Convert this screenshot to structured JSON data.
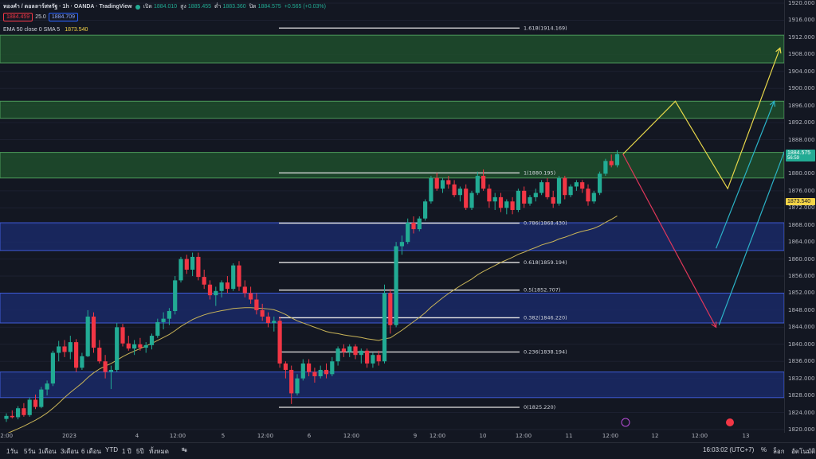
{
  "header": {
    "title": "ทองคำ / ดอลลาร์สหรัฐ · 1h · OANDA · TradingView",
    "ohlc": [
      {
        "label": "เปิด",
        "value": "1884.010"
      },
      {
        "label": "สูง",
        "value": "1885.455"
      },
      {
        "label": "ต่ำ",
        "value": "1883.360"
      },
      {
        "label": "ปิด",
        "value": "1884.575"
      }
    ],
    "change": "+0.565 (+0.03%)",
    "bid": "1884.459",
    "spread": "25.0",
    "ask": "1884.709",
    "indicator": "EMA 50 close 0 SMA 5",
    "indicator_value": "1873.540"
  },
  "price_tags": {
    "current": "1884.575",
    "countdown": "56:59",
    "ema": "1873.540"
  },
  "colors": {
    "background": "#131722",
    "up": "#22ab94",
    "down": "#f23645",
    "green_zone": "#1e4d2b",
    "blue_zone": "#1a2a6c",
    "ema": "#c9b458",
    "arrow_yellow": "#e8d84a",
    "arrow_cyan": "#2bb3c7",
    "arrow_red": "#e0375a"
  },
  "chart_data": {
    "type": "candlestick",
    "title": "ทองคำ / ดอลลาร์สหรัฐ · 1h · OANDA",
    "ylim": [
      1820,
      1920
    ],
    "y_ticks": [
      "1920.000",
      "1916.000",
      "1912.000",
      "1908.000",
      "1904.000",
      "1900.000",
      "1896.000",
      "1892.000",
      "1888.000",
      "1884.000",
      "1880.000",
      "1876.000",
      "1872.000",
      "1868.000",
      "1864.000",
      "1860.000",
      "1856.000",
      "1852.000",
      "1848.000",
      "1844.000",
      "1840.000",
      "1836.000",
      "1832.000",
      "1828.000",
      "1824.000",
      "1820.000"
    ],
    "x_ticks": [
      "12:00",
      "2023",
      "4",
      "12:00",
      "5",
      "12:00",
      "6",
      "12:00",
      "9",
      "12:00",
      "10",
      "12:00",
      "11",
      "12:00",
      "12",
      "12:00",
      "13"
    ],
    "fib_levels": [
      {
        "label": "1.618(1914.169)",
        "price": 1914.169
      },
      {
        "label": "1(1880.195)",
        "price": 1880.195
      },
      {
        "label": "0.786(1868.430)",
        "price": 1868.43
      },
      {
        "label": "0.618(1859.194)",
        "price": 1859.194
      },
      {
        "label": "0.5(1852.707)",
        "price": 1852.707
      },
      {
        "label": "0.382(1846.220)",
        "price": 1846.22
      },
      {
        "label": "0.236(1838.194)",
        "price": 1838.194
      },
      {
        "label": "0(1825.220)",
        "price": 1825.22
      }
    ],
    "zones": [
      {
        "kind": "supply",
        "top": 1912.5,
        "bottom": 1906.0
      },
      {
        "kind": "supply",
        "top": 1897.0,
        "bottom": 1893.0
      },
      {
        "kind": "supply",
        "top": 1885.0,
        "bottom": 1879.0
      },
      {
        "kind": "demand",
        "top": 1868.5,
        "bottom": 1862.0
      },
      {
        "kind": "demand",
        "top": 1852.0,
        "bottom": 1845.0
      },
      {
        "kind": "demand",
        "top": 1833.5,
        "bottom": 1827.5
      }
    ],
    "candles": [
      [
        1822.5,
        1823.8,
        1821.8,
        1823.2
      ],
      [
        1823.2,
        1824.5,
        1822.6,
        1822.9
      ],
      [
        1822.9,
        1825.5,
        1822.4,
        1825.0
      ],
      [
        1825.0,
        1826.2,
        1823.0,
        1823.4
      ],
      [
        1823.4,
        1827.5,
        1823.0,
        1827.0
      ],
      [
        1827.0,
        1828.2,
        1824.8,
        1825.3
      ],
      [
        1825.3,
        1830.0,
        1825.0,
        1829.4
      ],
      [
        1829.4,
        1831.5,
        1828.0,
        1830.8
      ],
      [
        1830.8,
        1838.5,
        1830.2,
        1838.0
      ],
      [
        1838.0,
        1840.8,
        1836.0,
        1839.5
      ],
      [
        1839.5,
        1841.0,
        1837.0,
        1838.2
      ],
      [
        1838.2,
        1842.0,
        1836.5,
        1840.5
      ],
      [
        1840.5,
        1841.2,
        1833.5,
        1834.5
      ],
      [
        1834.5,
        1838.0,
        1834.0,
        1837.2
      ],
      [
        1837.2,
        1848.0,
        1837.0,
        1846.5
      ],
      [
        1846.5,
        1847.5,
        1838.0,
        1839.2
      ],
      [
        1839.2,
        1841.0,
        1835.5,
        1836.0
      ],
      [
        1836.0,
        1837.5,
        1832.0,
        1833.5
      ],
      [
        1833.5,
        1835.0,
        1829.5,
        1834.0
      ],
      [
        1834.0,
        1845.0,
        1833.5,
        1844.0
      ],
      [
        1844.0,
        1844.8,
        1839.5,
        1840.2
      ],
      [
        1840.2,
        1842.0,
        1838.5,
        1839.0
      ],
      [
        1839.0,
        1841.0,
        1837.5,
        1840.0
      ],
      [
        1840.0,
        1841.5,
        1838.5,
        1839.2
      ],
      [
        1839.2,
        1840.5,
        1838.0,
        1839.8
      ],
      [
        1839.8,
        1842.5,
        1838.8,
        1842.0
      ],
      [
        1842.0,
        1846.0,
        1841.5,
        1845.2
      ],
      [
        1845.2,
        1847.5,
        1843.5,
        1846.0
      ],
      [
        1846.0,
        1848.5,
        1844.5,
        1847.8
      ],
      [
        1847.8,
        1856.0,
        1847.0,
        1855.0
      ],
      [
        1855.0,
        1860.5,
        1854.5,
        1860.0
      ],
      [
        1860.0,
        1861.0,
        1856.5,
        1857.5
      ],
      [
        1857.5,
        1861.5,
        1856.0,
        1860.5
      ],
      [
        1860.5,
        1861.5,
        1855.0,
        1855.8
      ],
      [
        1855.8,
        1857.5,
        1853.0,
        1854.0
      ],
      [
        1854.0,
        1855.0,
        1850.5,
        1851.5
      ],
      [
        1851.5,
        1853.5,
        1849.0,
        1852.5
      ],
      [
        1852.5,
        1855.0,
        1851.0,
        1854.5
      ],
      [
        1854.5,
        1856.0,
        1852.0,
        1853.0
      ],
      [
        1853.0,
        1859.0,
        1852.5,
        1858.5
      ],
      [
        1858.5,
        1859.5,
        1852.5,
        1853.5
      ],
      [
        1853.5,
        1855.0,
        1851.0,
        1852.0
      ],
      [
        1852.0,
        1853.5,
        1849.5,
        1850.5
      ],
      [
        1850.5,
        1852.0,
        1847.0,
        1848.0
      ],
      [
        1848.0,
        1849.5,
        1845.5,
        1846.5
      ],
      [
        1846.5,
        1847.5,
        1844.0,
        1845.0
      ],
      [
        1845.0,
        1846.5,
        1843.0,
        1845.5
      ],
      [
        1845.5,
        1846.5,
        1834.5,
        1835.5
      ],
      [
        1835.5,
        1836.0,
        1832.0,
        1834.0
      ],
      [
        1834.0,
        1835.0,
        1826.0,
        1828.5
      ],
      [
        1828.5,
        1833.0,
        1828.0,
        1832.0
      ],
      [
        1832.0,
        1836.5,
        1831.5,
        1835.5
      ],
      [
        1835.5,
        1836.5,
        1832.5,
        1833.5
      ],
      [
        1833.5,
        1834.5,
        1831.0,
        1832.5
      ],
      [
        1832.5,
        1835.0,
        1832.0,
        1834.0
      ],
      [
        1834.0,
        1835.5,
        1832.0,
        1833.0
      ],
      [
        1833.0,
        1837.0,
        1832.5,
        1836.0
      ],
      [
        1836.0,
        1839.5,
        1835.0,
        1839.0
      ],
      [
        1839.0,
        1840.0,
        1837.0,
        1838.2
      ],
      [
        1838.2,
        1840.0,
        1837.0,
        1839.5
      ],
      [
        1839.5,
        1840.0,
        1836.5,
        1837.5
      ],
      [
        1837.5,
        1839.0,
        1835.5,
        1838.5
      ],
      [
        1838.5,
        1839.0,
        1834.5,
        1835.5
      ],
      [
        1835.5,
        1838.0,
        1834.5,
        1837.5
      ],
      [
        1837.5,
        1838.5,
        1835.0,
        1836.0
      ],
      [
        1836.0,
        1854.0,
        1835.5,
        1852.0
      ],
      [
        1852.0,
        1853.0,
        1842.5,
        1844.5
      ],
      [
        1844.5,
        1864.0,
        1844.0,
        1863.0
      ],
      [
        1863.0,
        1865.5,
        1861.0,
        1864.0
      ],
      [
        1864.0,
        1869.5,
        1863.5,
        1868.5
      ],
      [
        1868.5,
        1870.0,
        1866.0,
        1867.0
      ],
      [
        1867.0,
        1870.0,
        1866.5,
        1869.5
      ],
      [
        1869.5,
        1874.0,
        1869.0,
        1873.5
      ],
      [
        1873.5,
        1879.5,
        1873.0,
        1879.0
      ],
      [
        1879.0,
        1880.2,
        1876.0,
        1876.5
      ],
      [
        1876.5,
        1879.0,
        1875.5,
        1878.5
      ],
      [
        1878.5,
        1879.5,
        1876.5,
        1877.5
      ],
      [
        1877.5,
        1878.5,
        1874.5,
        1875.0
      ],
      [
        1875.0,
        1877.0,
        1873.5,
        1876.5
      ],
      [
        1876.5,
        1877.5,
        1871.5,
        1872.0
      ],
      [
        1872.0,
        1876.0,
        1871.5,
        1875.5
      ],
      [
        1875.5,
        1880.5,
        1875.0,
        1879.5
      ],
      [
        1879.5,
        1881.0,
        1876.0,
        1876.5
      ],
      [
        1876.5,
        1877.5,
        1872.0,
        1873.5
      ],
      [
        1873.5,
        1875.5,
        1871.5,
        1874.5
      ],
      [
        1874.5,
        1875.5,
        1871.0,
        1872.0
      ],
      [
        1872.0,
        1874.0,
        1870.5,
        1873.5
      ],
      [
        1873.5,
        1874.5,
        1870.5,
        1871.5
      ],
      [
        1871.5,
        1876.5,
        1871.0,
        1876.0
      ],
      [
        1876.0,
        1877.0,
        1872.0,
        1873.0
      ],
      [
        1873.0,
        1875.0,
        1872.5,
        1874.5
      ],
      [
        1874.5,
        1876.5,
        1873.5,
        1875.5
      ],
      [
        1875.5,
        1878.5,
        1875.0,
        1878.0
      ],
      [
        1878.0,
        1879.0,
        1874.0,
        1874.5
      ],
      [
        1874.5,
        1876.0,
        1872.0,
        1873.0
      ],
      [
        1873.0,
        1879.5,
        1872.5,
        1879.0
      ],
      [
        1879.0,
        1879.5,
        1874.0,
        1875.0
      ],
      [
        1875.0,
        1877.5,
        1874.5,
        1877.0
      ],
      [
        1877.0,
        1878.5,
        1876.0,
        1878.0
      ],
      [
        1878.0,
        1878.5,
        1875.5,
        1876.5
      ],
      [
        1876.5,
        1877.5,
        1872.5,
        1873.5
      ],
      [
        1873.5,
        1876.0,
        1873.0,
        1875.5
      ],
      [
        1875.5,
        1880.5,
        1875.0,
        1880.0
      ],
      [
        1880.0,
        1883.5,
        1879.5,
        1883.0
      ],
      [
        1883.0,
        1884.5,
        1881.5,
        1882.0
      ],
      [
        1882.0,
        1885.5,
        1881.5,
        1884.6
      ]
    ],
    "ema50": [
      1819.0,
      1819.6,
      1820.2,
      1820.8,
      1821.5,
      1822.2,
      1823.0,
      1823.9,
      1825.0,
      1826.2,
      1827.5,
      1828.7,
      1829.8,
      1830.9,
      1832.2,
      1833.3,
      1834.2,
      1834.9,
      1835.5,
      1836.3,
      1837.1,
      1837.8,
      1838.4,
      1839.0,
      1839.6,
      1840.2,
      1840.9,
      1841.6,
      1842.3,
      1843.2,
      1844.2,
      1845.0,
      1845.8,
      1846.4,
      1846.9,
      1847.3,
      1847.6,
      1847.9,
      1848.1,
      1848.4,
      1848.5,
      1848.6,
      1848.6,
      1848.5,
      1848.4,
      1848.3,
      1848.1,
      1847.6,
      1847.0,
      1846.2,
      1845.5,
      1845.0,
      1844.5,
      1844.0,
      1843.5,
      1843.0,
      1842.7,
      1842.5,
      1842.2,
      1842.0,
      1841.8,
      1841.6,
      1841.3,
      1841.1,
      1840.9,
      1841.3,
      1841.5,
      1842.4,
      1843.3,
      1844.3,
      1845.3,
      1846.3,
      1847.4,
      1848.7,
      1849.8,
      1850.9,
      1851.9,
      1852.8,
      1853.7,
      1854.5,
      1855.3,
      1856.3,
      1857.1,
      1857.8,
      1858.5,
      1859.2,
      1859.8,
      1860.4,
      1861.1,
      1861.6,
      1862.2,
      1862.7,
      1863.3,
      1863.7,
      1864.1,
      1864.7,
      1865.1,
      1865.6,
      1866.1,
      1866.5,
      1866.8,
      1867.2,
      1867.8,
      1868.6,
      1869.3,
      1870.1
    ],
    "projections": [
      {
        "color": "yellow",
        "points": [
          [
            106,
            1884.6
          ],
          [
            115,
            1897.0
          ],
          [
            124,
            1876.5
          ],
          [
            133,
            1909.5
          ]
        ]
      },
      {
        "color": "red",
        "points": [
          [
            106,
            1884.6
          ],
          [
            122,
            1844.0
          ]
        ]
      },
      {
        "color": "cyan",
        "points": [
          [
            122,
            1862.5
          ],
          [
            132,
            1897.0
          ]
        ]
      },
      {
        "color": "cyan",
        "points": [
          [
            122.5,
            1844.5
          ],
          [
            137,
            1897.0
          ]
        ]
      }
    ]
  },
  "time_axis": {
    "clock": "16:03:02 (UTC+7)"
  },
  "bottom_bar": {
    "ranges": [
      "1วัน",
      "5วัน",
      "1เดือน",
      "3เดือน",
      "6 เดือน",
      "YTD",
      "1 ปี",
      "5ปี",
      "ทั้งหมด"
    ],
    "percent": "%",
    "log": "ล็อก",
    "auto": "อัตโนมัติ"
  }
}
